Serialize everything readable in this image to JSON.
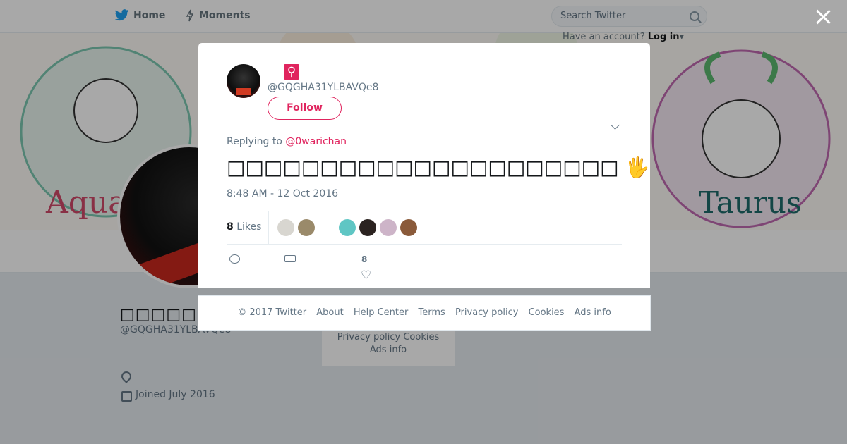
{
  "nav": {
    "home_label": "Home",
    "moments_label": "Moments",
    "search_placeholder": "Search Twitter",
    "have_account_text": "Have an account?",
    "login_label": "Log in"
  },
  "profile": {
    "name": "□□□□□□□□□□",
    "handle": "@GQGHA31YLBAVQe8",
    "joined": "Joined July 2016",
    "side_footer_line1": "Privacy policy   Cookies",
    "side_footer_line2": "Ads info"
  },
  "tweet": {
    "handle": "@GQGHA31YLBAVQe8",
    "badge_icon": "female-sign-icon",
    "follow_label": "Follow",
    "replying_prefix": "Replying to",
    "replying_to": "@0warichan",
    "text": "□□□□□□□□□□□□□□□□□□□□□ 🖐",
    "timestamp": "8:48 AM - 12 Oct 2016",
    "likes_count": "8",
    "likes_label": "Likes",
    "action_like_count": "8"
  },
  "footer": {
    "links": [
      "© 2017 Twitter",
      "About",
      "Help Center",
      "Terms",
      "Privacy policy",
      "Cookies",
      "Ads info"
    ]
  },
  "colors": {
    "accent": "#e0245e",
    "twitter_blue": "#1da1f2",
    "text_secondary": "#657786"
  }
}
